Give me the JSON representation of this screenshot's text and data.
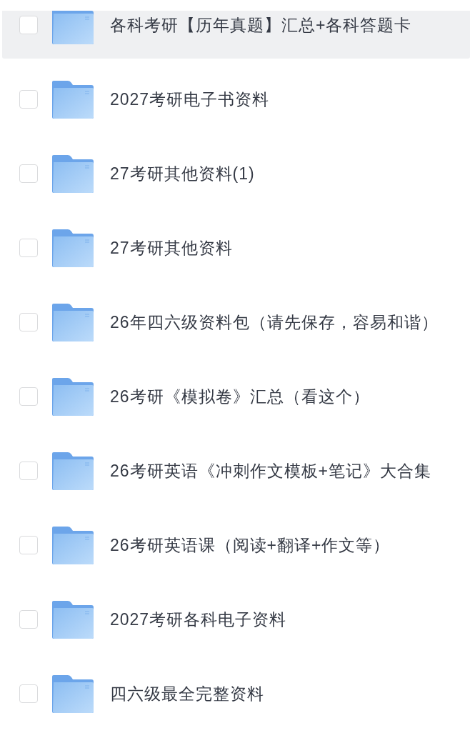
{
  "items": [
    {
      "name": "各科考研【历年真题】汇总+各科答题卡",
      "selected": true,
      "checked": false
    },
    {
      "name": "2027考研电子书资料",
      "selected": false,
      "checked": false
    },
    {
      "name": "27考研其他资料(1)",
      "selected": false,
      "checked": false
    },
    {
      "name": "27考研其他资料",
      "selected": false,
      "checked": false
    },
    {
      "name": "26年四六级资料包（请先保存，容易和谐）",
      "selected": false,
      "checked": false
    },
    {
      "name": "26考研《模拟卷》汇总（看这个）",
      "selected": false,
      "checked": false
    },
    {
      "name": "26考研英语《冲刺作文模板+笔记》大合集",
      "selected": false,
      "checked": false
    },
    {
      "name": "26考研英语课（阅读+翻译+作文等）",
      "selected": false,
      "checked": false
    },
    {
      "name": "2027考研各科电子资料",
      "selected": false,
      "checked": false
    },
    {
      "name": "四六级最全完整资料",
      "selected": false,
      "checked": false
    }
  ]
}
